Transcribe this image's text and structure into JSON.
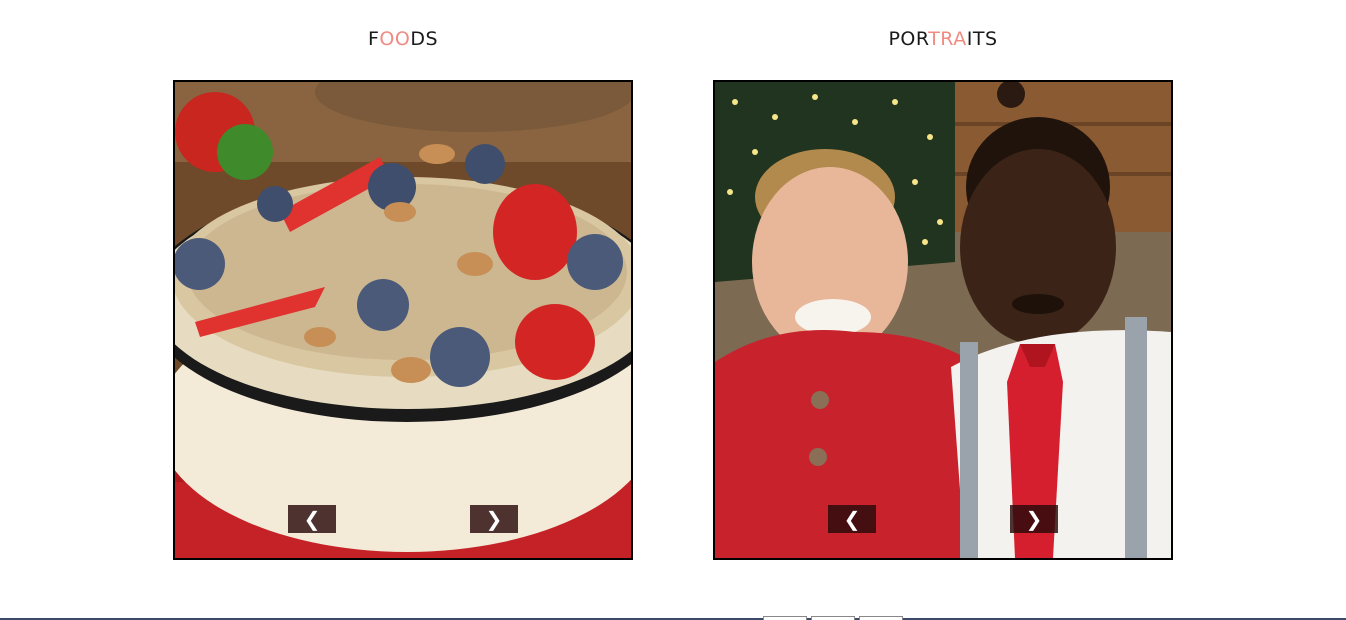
{
  "galleries": [
    {
      "title_parts": [
        "F",
        "OO",
        "DS"
      ],
      "image_alt": "Bowl of oatmeal topped with strawberries, blueberries and almonds",
      "prev_label": "❮",
      "next_label": "❯"
    },
    {
      "title_parts": [
        "POR",
        "TRA",
        "ITS"
      ],
      "image_alt": "Two smiling boys in festive clothes in front of a Christmas tree",
      "prev_label": "❮",
      "next_label": "❯"
    }
  ],
  "colors": {
    "accent": "#f08b83",
    "nav_button": "#280a0a",
    "frame_border": "#000000"
  }
}
